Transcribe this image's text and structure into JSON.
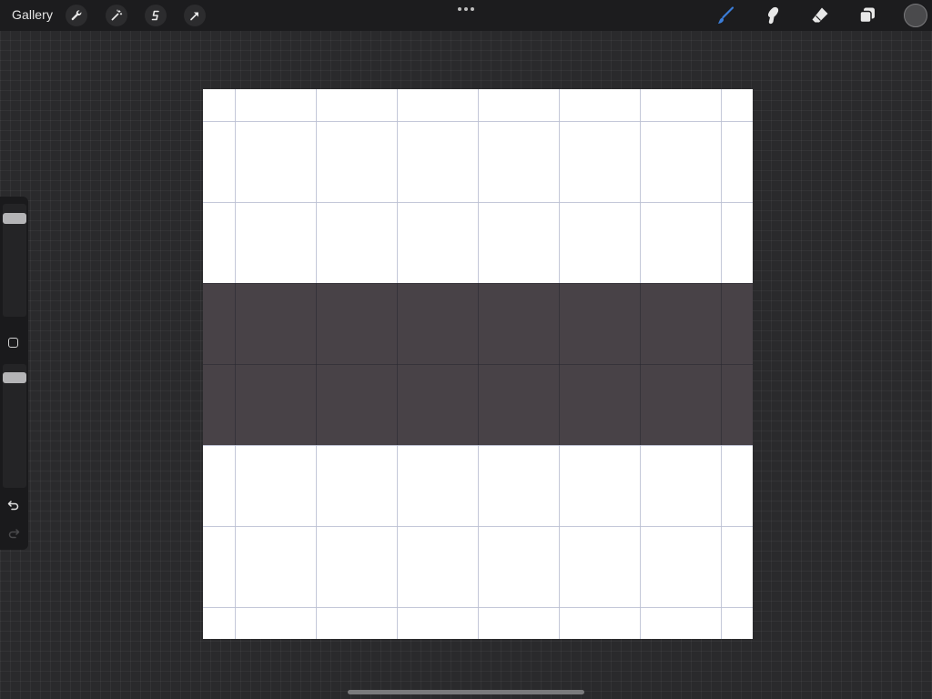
{
  "app": {
    "gallery_label": "Gallery"
  },
  "toolbar": {
    "left_tools": [
      "wrench-icon",
      "magic-wand-icon",
      "selection-s-icon",
      "transform-arrow-icon"
    ],
    "right_tools": [
      "brush-icon",
      "smudge-icon",
      "eraser-icon",
      "layers-icon"
    ],
    "active_tool": "brush-icon",
    "active_color": "#3b7dd8",
    "current_color": "#4a4a4c"
  },
  "sidebar": {
    "brush_size_level": 0.95,
    "opacity_level": 0.95,
    "icons": [
      "modify-square-icon",
      "undo-icon",
      "redo-icon"
    ]
  },
  "canvas": {
    "background_color": "#ffffff",
    "band_color": "#484247",
    "grid_color": "#bcc0d2"
  }
}
